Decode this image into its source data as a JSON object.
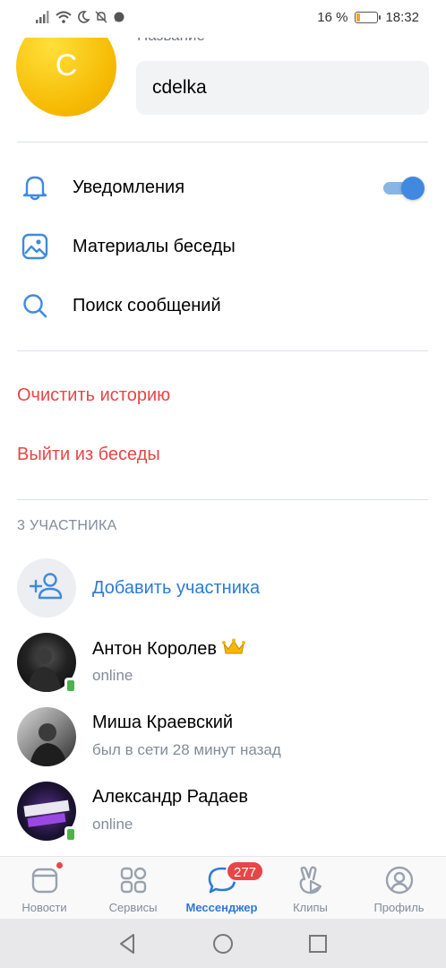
{
  "status_bar": {
    "battery_percent": "16 %",
    "battery_level": 0.16,
    "time": "18:32",
    "icons": [
      "signal-icon",
      "wifi-icon",
      "moon-icon",
      "bell-off-icon",
      "chat-icon"
    ]
  },
  "chat": {
    "avatar_letter": "C",
    "avatar_color": "#f5b800",
    "title_label": "Название",
    "title_value": "cdelka"
  },
  "menu": {
    "notifications": {
      "label": "Уведомления",
      "icon": "bell-icon",
      "toggle_on": true
    },
    "materials": {
      "label": "Материалы беседы",
      "icon": "image-icon"
    },
    "search": {
      "label": "Поиск сообщений",
      "icon": "search-icon"
    }
  },
  "actions": {
    "clear_history": "Очистить историю",
    "leave_chat": "Выйти из беседы"
  },
  "members_section": {
    "caption": "3 УЧАСТНИКА",
    "add_label": "Добавить участника",
    "members": [
      {
        "name": "Антон Королев",
        "status": "online",
        "online_mobile": true,
        "crown": true
      },
      {
        "name": "Миша Краевский",
        "status": "был в сети 28 минут назад",
        "online_mobile": false
      },
      {
        "name": "Александр Радаев",
        "status": "online",
        "online_mobile": true
      }
    ]
  },
  "tabbar": {
    "tabs": [
      {
        "label": "Новости",
        "icon": "news-icon",
        "has_dot": true
      },
      {
        "label": "Сервисы",
        "icon": "services-icon"
      },
      {
        "label": "Мессенджер",
        "icon": "messenger-icon",
        "badge": "277",
        "active": true
      },
      {
        "label": "Клипы",
        "icon": "clips-icon"
      },
      {
        "label": "Профиль",
        "icon": "profile-icon"
      }
    ]
  },
  "colors": {
    "accent": "#2c7ad6",
    "danger": "#e64646",
    "secondary_text": "#818c99",
    "online": "#4bb34b"
  }
}
